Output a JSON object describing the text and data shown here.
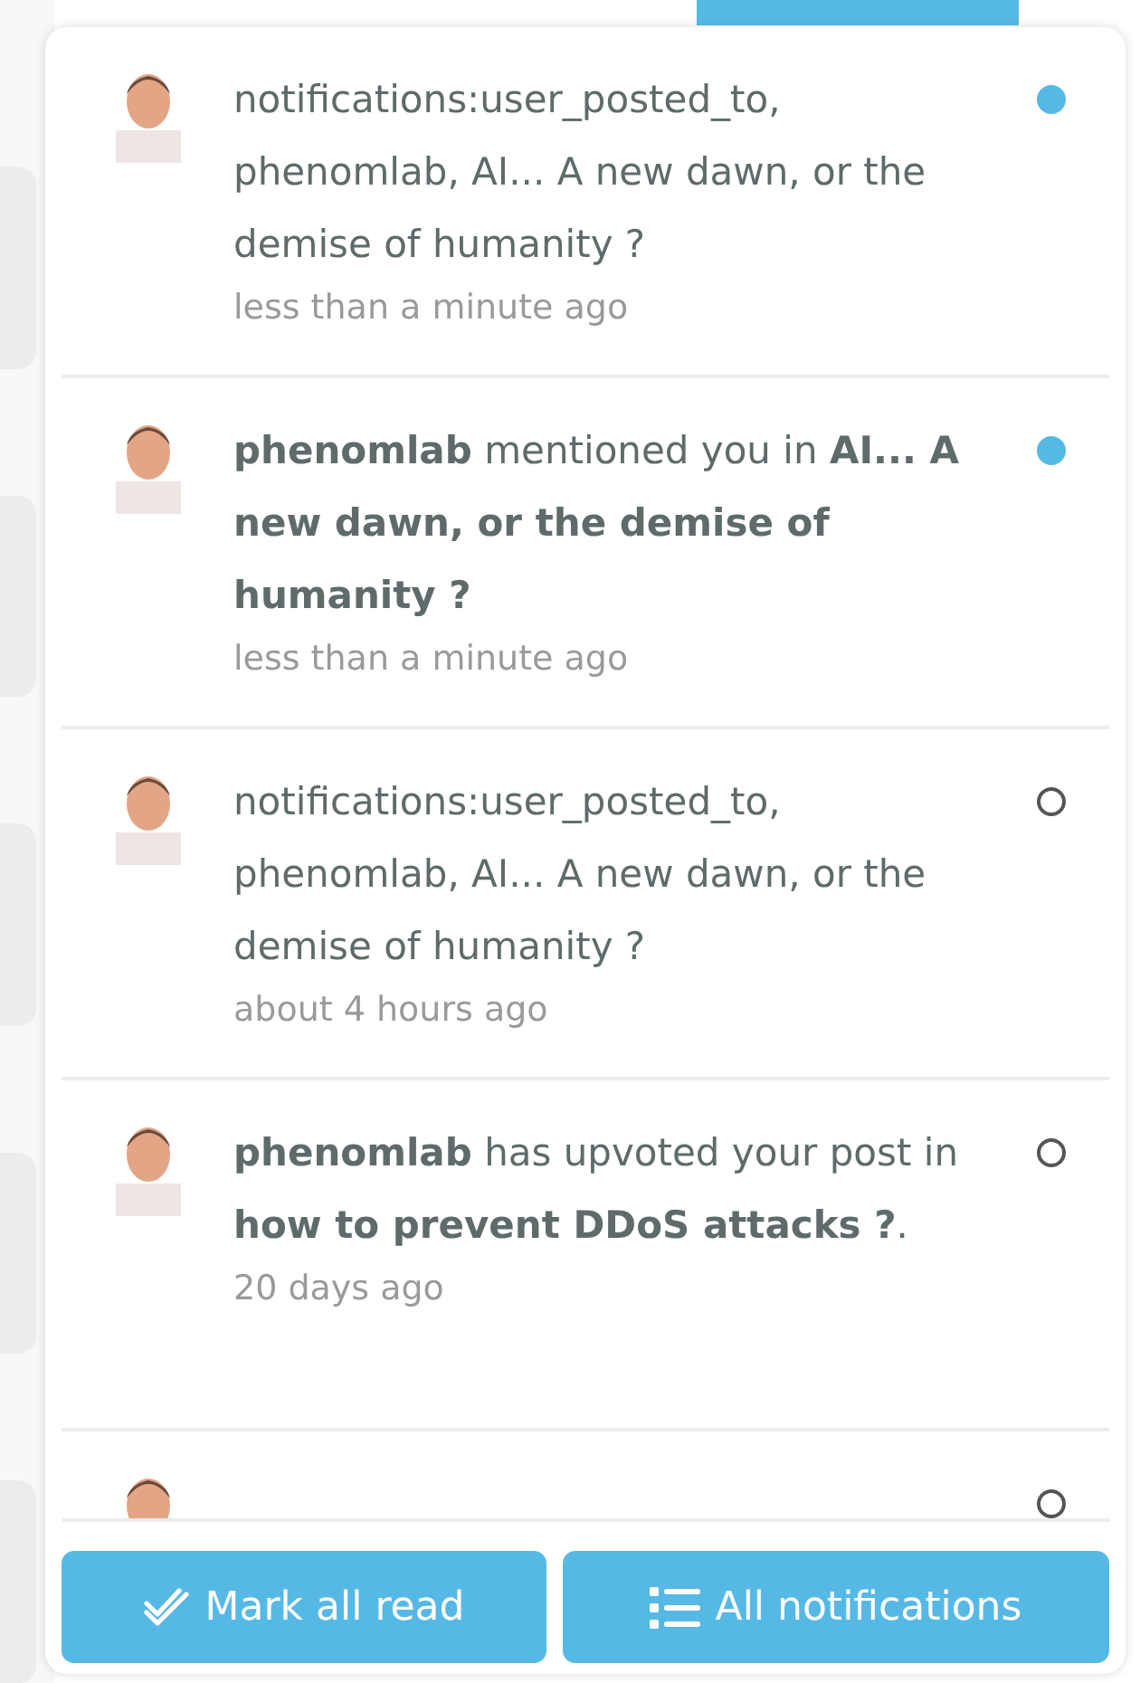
{
  "notifications": [
    {
      "text": "notifications:user_posted_to, phenomlab, AI... A new dawn, or the demise of humanity ?",
      "time": "less than a minute ago",
      "unread": true
    },
    {
      "text": "**phenomlab** mentioned you in **AI... A new dawn, or the demise of humanity ?**",
      "time": "less than a minute ago",
      "unread": true
    },
    {
      "text": "notifications:user_posted_to, phenomlab, AI... A new dawn, or the demise of humanity ?",
      "time": "about 4 hours ago",
      "unread": false
    },
    {
      "text": "**phenomlab** has upvoted your post in **how to prevent DDoS attacks ?**.",
      "time": "20 days ago",
      "unread": false
    },
    {
      "unread": false
    }
  ],
  "buttons": [
    {
      "kind": "mark-read",
      "label": "Mark all read"
    },
    {
      "kind": "all",
      "label": "All notifications"
    }
  ]
}
